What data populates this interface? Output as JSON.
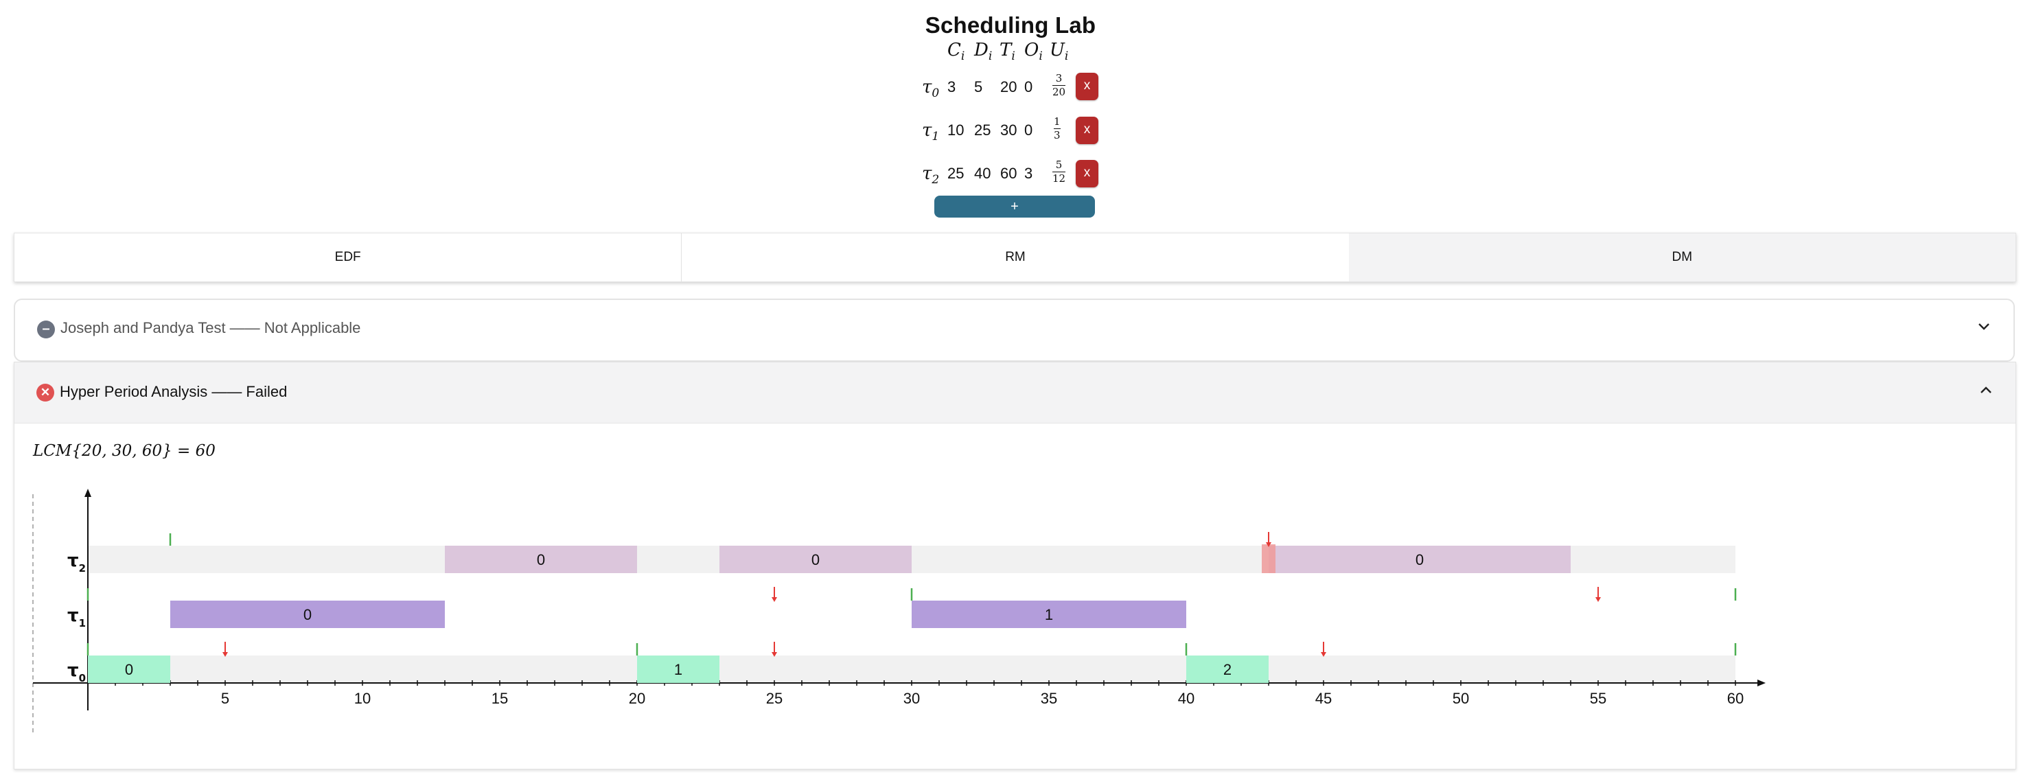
{
  "app": {
    "title": "Scheduling Lab"
  },
  "task_table": {
    "headers": [
      {
        "sym": "C",
        "sub": "i"
      },
      {
        "sym": "D",
        "sub": "i"
      },
      {
        "sym": "T",
        "sub": "i"
      },
      {
        "sym": "O",
        "sub": "i"
      },
      {
        "sym": "U",
        "sub": "i"
      }
    ],
    "rows": [
      {
        "label": "τ",
        "sub": "0",
        "C": "3",
        "D": "5",
        "T": "20",
        "O": "0",
        "U_num": "3",
        "U_den": "20",
        "delete": "x"
      },
      {
        "label": "τ",
        "sub": "1",
        "C": "10",
        "D": "25",
        "T": "30",
        "O": "0",
        "U_num": "1",
        "U_den": "3",
        "delete": "x"
      },
      {
        "label": "τ",
        "sub": "2",
        "C": "25",
        "D": "40",
        "T": "60",
        "O": "3",
        "U_num": "5",
        "U_den": "12",
        "delete": "x"
      }
    ],
    "add_label": "+"
  },
  "tabs": [
    {
      "label": "EDF",
      "active": false
    },
    {
      "label": "RM",
      "active": false
    },
    {
      "label": "DM",
      "active": true
    }
  ],
  "tests": [
    {
      "name": "Joseph and Pandya Test —— Not Applicable",
      "status": "not-applicable",
      "expanded": false,
      "status_color": "#6b7280"
    },
    {
      "name": "Hyper Period Analysis —— Failed",
      "status": "failed",
      "expanded": true,
      "status_color": "#e05252"
    }
  ],
  "analysis": {
    "lcm_text": "LCM{20, 30, 60} = 60"
  },
  "chart_data": {
    "type": "gantt",
    "x_range": [
      0,
      60
    ],
    "x_ticks": [
      5,
      10,
      15,
      20,
      25,
      30,
      35,
      40,
      45,
      50,
      55,
      60
    ],
    "tasks": [
      {
        "label": "τ",
        "sub": "0",
        "color": "#a7f3d0",
        "jobs": [
          {
            "start": 0,
            "end": 3,
            "label": "0"
          },
          {
            "start": 20,
            "end": 23,
            "label": "1"
          },
          {
            "start": 40,
            "end": 43,
            "label": "2"
          }
        ],
        "releases": [
          0,
          20,
          40,
          60
        ],
        "deadlines": [
          5,
          25,
          45
        ]
      },
      {
        "label": "τ",
        "sub": "1",
        "color": "#b39ddb",
        "jobs": [
          {
            "start": 3,
            "end": 13,
            "label": "0"
          },
          {
            "start": 30,
            "end": 40,
            "label": "1"
          }
        ],
        "releases": [
          0,
          30,
          60
        ],
        "deadlines": [
          25,
          55
        ]
      },
      {
        "label": "τ",
        "sub": "2",
        "color": "#dcc6dc",
        "jobs": [
          {
            "start": 13,
            "end": 20,
            "label": "0"
          },
          {
            "start": 23,
            "end": 30,
            "label": "0"
          },
          {
            "start": 43,
            "end": 54,
            "label": "0"
          }
        ],
        "releases": [
          3
        ],
        "deadlines": [
          43
        ],
        "missed_deadline": 43
      }
    ],
    "colors": {
      "release": "#4caf50",
      "deadline": "#e53935",
      "miss": "#ef9a9a"
    }
  }
}
